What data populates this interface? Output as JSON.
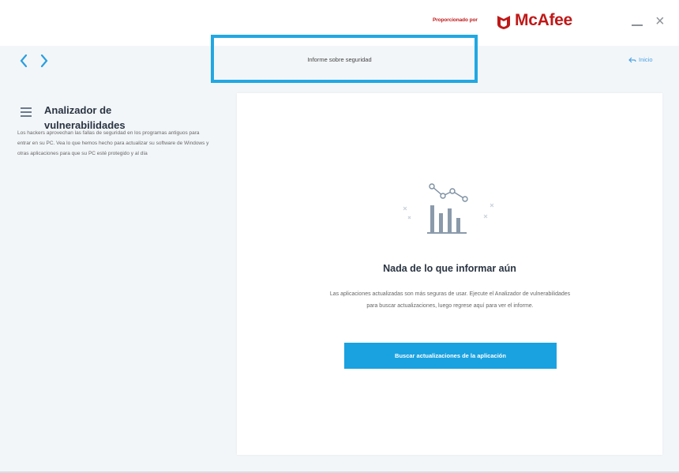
{
  "titlebar": {
    "powered_by": "Proporcionado por",
    "brand": "McAfee",
    "brand_color": "#c01818",
    "icons": [
      "mcafee-shield-icon",
      "minimize-icon",
      "close-icon"
    ]
  },
  "nav": {
    "page_title": "Informe sobre seguridad",
    "home_label": "Inicio",
    "highlight_color": "#21a8e2"
  },
  "sidebar": {
    "title": "Analizador de vulnerabilidades",
    "description": "Los hackers aprovechan las fallas de seguridad en los programas antiguos para entrar en su PC. Vea lo que hemos hecho para actualizar su software de Windows y otras aplicaciones para que su PC esté protegido y al día"
  },
  "card": {
    "heading": "Nada de lo que informar aún",
    "body": "Las aplicaciones actualizadas son más seguras de usar. Ejecute el Analizador de vulnerabilidades para buscar actualizaciones, luego regrese aquí para ver el informe.",
    "button_label": "Buscar actualizaciones de la aplicación",
    "accent_color": "#1aa2e0"
  }
}
